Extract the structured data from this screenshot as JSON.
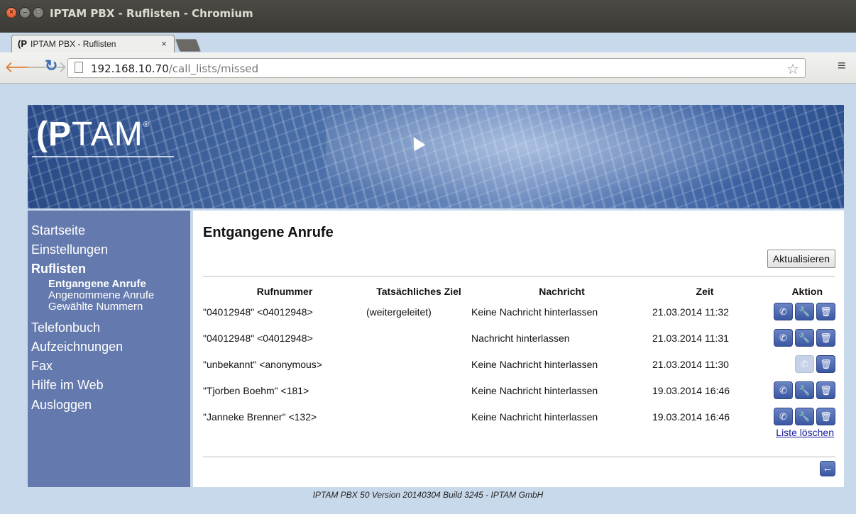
{
  "window": {
    "title": "IPTAM PBX - Ruflisten - Chromium"
  },
  "tab": {
    "favicon": "(P",
    "title": "IPTAM PBX - Ruflisten",
    "close": "×"
  },
  "toolbar": {
    "url_host": "192.168.10.70",
    "url_path": "/call_lists/missed"
  },
  "logo": {
    "text_bold": "(P",
    "text_reg": "TAM",
    "mark": "®"
  },
  "sidebar": {
    "items": [
      {
        "label": "Startseite"
      },
      {
        "label": "Einstellungen"
      },
      {
        "label": "Ruflisten"
      },
      {
        "label": "Telefonbuch"
      },
      {
        "label": "Aufzeichnungen"
      },
      {
        "label": "Fax"
      },
      {
        "label": "Hilfe im Web"
      },
      {
        "label": "Ausloggen"
      }
    ],
    "subitems": [
      {
        "label": "Entgangene Anrufe"
      },
      {
        "label": "Angenommene Anrufe"
      },
      {
        "label": "Gewählte Nummern"
      }
    ]
  },
  "main": {
    "title": "Entgangene Anrufe",
    "refresh_label": "Aktualisieren",
    "clear_label": "Liste löschen",
    "columns": [
      "Rufnummer",
      "Tatsächliches Ziel",
      "Nachricht",
      "Zeit",
      "Aktion"
    ],
    "rows": [
      {
        "number": "\"04012948\" <04012948>",
        "target": "(weitergeleitet)",
        "message": "Keine Nachricht hinterlassen",
        "time": "21.03.2014 11:32"
      },
      {
        "number": "\"04012948\" <04012948>",
        "target": "",
        "message": "Nachricht hinterlassen",
        "time": "21.03.2014 11:31"
      },
      {
        "number": "\"unbekannt\" <anonymous>",
        "target": "",
        "message": "Keine Nachricht hinterlassen",
        "time": "21.03.2014 11:30"
      },
      {
        "number": "\"Tjorben Boehm\" <181>",
        "target": "",
        "message": "Keine Nachricht hinterlassen",
        "time": "19.03.2014 16:46"
      },
      {
        "number": "\"Janneke Brenner\" <132>",
        "target": "",
        "message": "Keine Nachricht hinterlassen",
        "time": "19.03.2014 16:46"
      }
    ]
  },
  "footer": {
    "text": "IPTAM PBX 50 Version 20140304 Build 3245 - IPTAM GmbH"
  },
  "icons": {
    "call": "phone-icon",
    "edit": "wrench-icon",
    "delete": "trash-icon",
    "back": "arrow-left-icon"
  }
}
